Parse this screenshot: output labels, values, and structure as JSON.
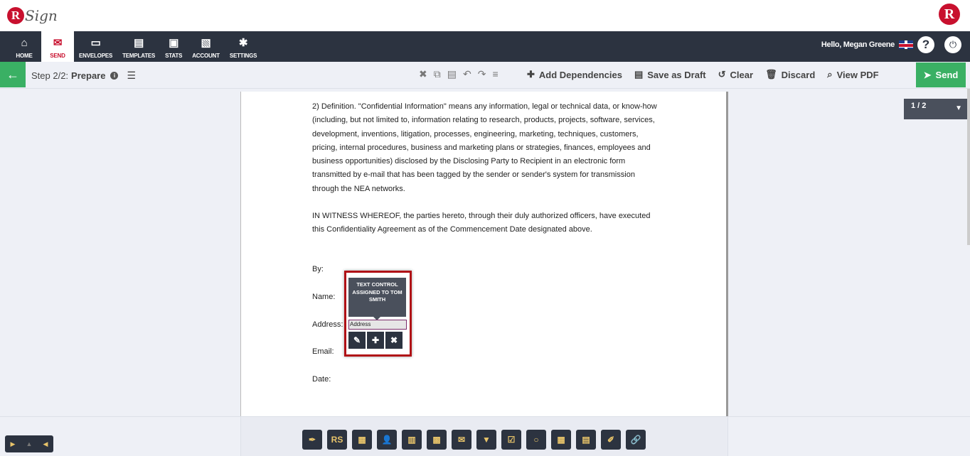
{
  "brand": {
    "logo_letter": "R",
    "logo_text": "Sign"
  },
  "nav": {
    "items": [
      {
        "label": "HOME",
        "icon": "⌂"
      },
      {
        "label": "SEND",
        "icon": "✉"
      },
      {
        "label": "ENVELOPES",
        "icon": "▭"
      },
      {
        "label": "TEMPLATES",
        "icon": "▤"
      },
      {
        "label": "STATS",
        "icon": "▣"
      },
      {
        "label": "ACCOUNT",
        "icon": "▧"
      },
      {
        "label": "SETTINGS",
        "icon": "✱"
      }
    ],
    "greeting": "Hello, Megan Greene",
    "help": "?",
    "power": "⏻"
  },
  "toolbar": {
    "step_prefix": "Step 2/2:",
    "step_name": "Prepare",
    "icons": [
      "✖",
      "⧉",
      "▤",
      "↶",
      "↷",
      "≡"
    ],
    "actions": [
      {
        "label": "Add Dependencies",
        "icon": "✚"
      },
      {
        "label": "Save as Draft",
        "icon": "▤"
      },
      {
        "label": "Clear",
        "icon": "↺"
      },
      {
        "label": "Discard",
        "icon": "🗑"
      },
      {
        "label": "View PDF",
        "icon": "⌕"
      }
    ],
    "send_label": "Send",
    "send_icon": "➤",
    "back_icon": "←"
  },
  "document": {
    "paragraphs": [
      "2) Definition.  \"Confidential Information\" means any information, legal or technical data, or know-how (including, but not limited to, information relating to research, products, projects, software, services, development, inventions, litigation, processes, engineering, marketing, techniques, customers, pricing, internal procedures, business and marketing plans or strategies, finances, employees and business opportunities) disclosed by the Disclosing Party to Recipient in an electronic form transmitted by e-mail that has been tagged by the sender or sender's system for transmission through the NEA networks.",
      "IN WITNESS WHEREOF, the parties hereto, through their duly authorized officers, have executed this Confidentiality Agreement as of the Commencement Date designated above."
    ],
    "fields": {
      "by": "By:",
      "name": "Name:",
      "address": "Address:",
      "email": "Email:",
      "date": "Date:"
    }
  },
  "page_indicator": {
    "label": "1 / 2",
    "caret": "▼"
  },
  "control_popup": {
    "tooltip": "TEXT CONTROL ASSIGNED TO TOM SMITH",
    "value": "Address",
    "buttons": [
      "✎",
      "✚",
      "✖"
    ]
  },
  "bottom_controls": [
    "✒",
    "RS",
    "▦",
    "👤",
    "▥",
    "▩",
    "✉",
    "▼",
    "☑",
    "○",
    "▦",
    "▤",
    "✐",
    "🔗"
  ],
  "nav_mini": [
    "▶",
    "▲",
    "◀"
  ]
}
